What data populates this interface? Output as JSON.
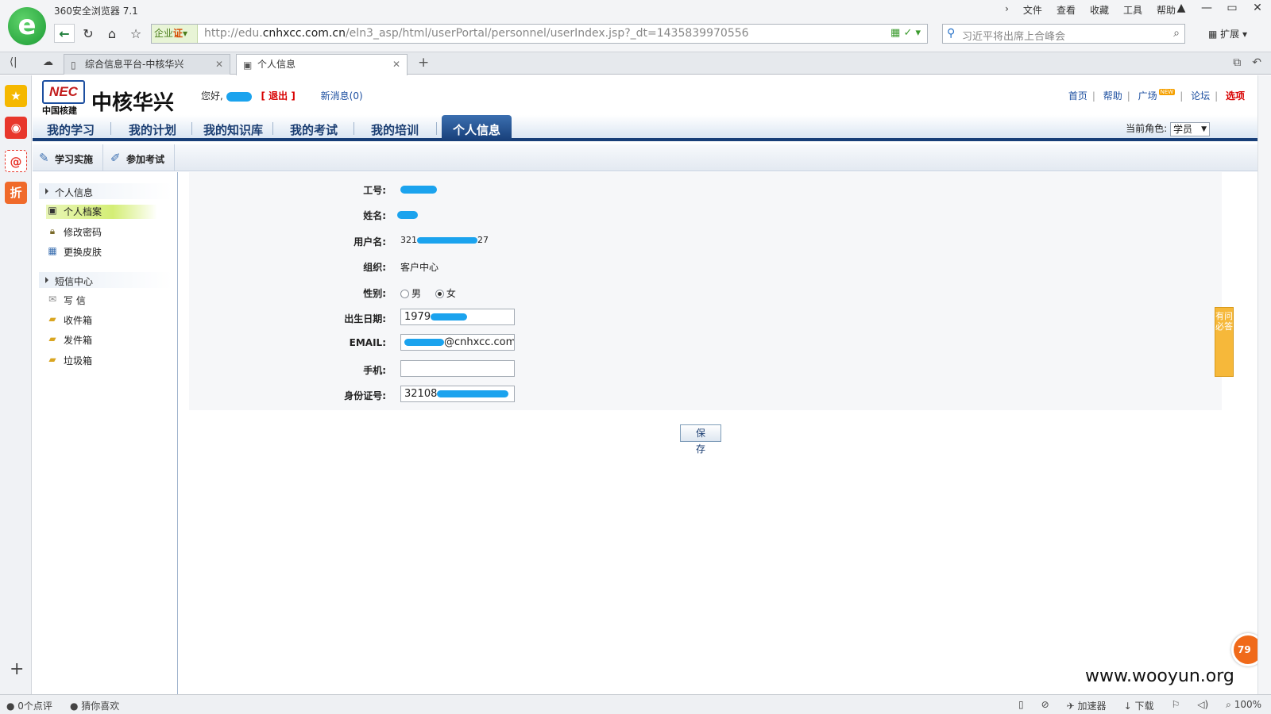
{
  "browser": {
    "app_title": "360安全浏览器 7.1",
    "menu": [
      "文件",
      "查看",
      "收藏",
      "工具",
      "帮助"
    ],
    "enterprise_badge": "企业",
    "enterprise_cert": "证",
    "url_prefix": "http://edu.",
    "url_domain": "cnhxcc.com.cn",
    "url_path": "/eln3_asp/html/userPortal/personnel/userIndex.jsp?_dt=1435839970556",
    "search_placeholder": "习近平将出席上合峰会",
    "extensions_label": "扩展",
    "tabs": [
      {
        "label": "综合信息平台-中核华兴"
      },
      {
        "label": "个人信息"
      }
    ]
  },
  "header": {
    "brand_logo": "NEC",
    "brand_caption": "中国核建",
    "company_name": "中核华兴",
    "greeting": "您好,",
    "logout_label": "退出",
    "new_message": "新消息(0)",
    "links": [
      "首页",
      "帮助",
      "广场",
      "论坛",
      "选项"
    ],
    "new_badge": "NEW"
  },
  "nav": {
    "items": [
      "我的学习",
      "我的计划",
      "我的知识库",
      "我的考试",
      "我的培训",
      "个人信息"
    ],
    "active_index": 5,
    "role_label": "当前角色:",
    "role_value": "学员"
  },
  "subbar": {
    "buttons": [
      "学习实施",
      "参加考试"
    ]
  },
  "sidebar": {
    "groups": [
      {
        "title": "个人信息",
        "items": [
          "个人档案",
          "修改密码",
          "更换皮肤"
        ]
      },
      {
        "title": "短信中心",
        "items": [
          "写 信",
          "收件箱",
          "发件箱",
          "垃圾箱"
        ]
      }
    ]
  },
  "form": {
    "employee_id_label": "工号:",
    "name_label": "姓名:",
    "username_label": "用户名:",
    "username_value_start": "321",
    "username_value_end": "27",
    "org_label": "组织:",
    "org_value": "客户中心",
    "gender_label": "性别:",
    "gender_male": "男",
    "gender_female": "女",
    "gender_selected": "女",
    "birth_label": "出生日期:",
    "birth_value_start": "1979",
    "email_label": "EMAIL:",
    "email_value_end": "@cnhxcc.com.c",
    "phone_label": "手机:",
    "phone_value": "",
    "idcard_label": "身份证号:",
    "idcard_value_start": "32108",
    "save_label": "保 存"
  },
  "floating": {
    "help_tab": "有问必答",
    "ball_number": "79"
  },
  "statusbar": {
    "comments": "0个点评",
    "guess": "猜你喜欢",
    "accelerator": "加速器",
    "download": "下载",
    "zoom": "100%"
  },
  "watermark": "www.wooyun.org",
  "colors": {
    "nav_dark": "#173e78",
    "link_blue": "#1d4fa0",
    "alert_red": "#d80000",
    "redaction_blue": "#1ba3ee",
    "selected_green": "#d4ee76"
  }
}
